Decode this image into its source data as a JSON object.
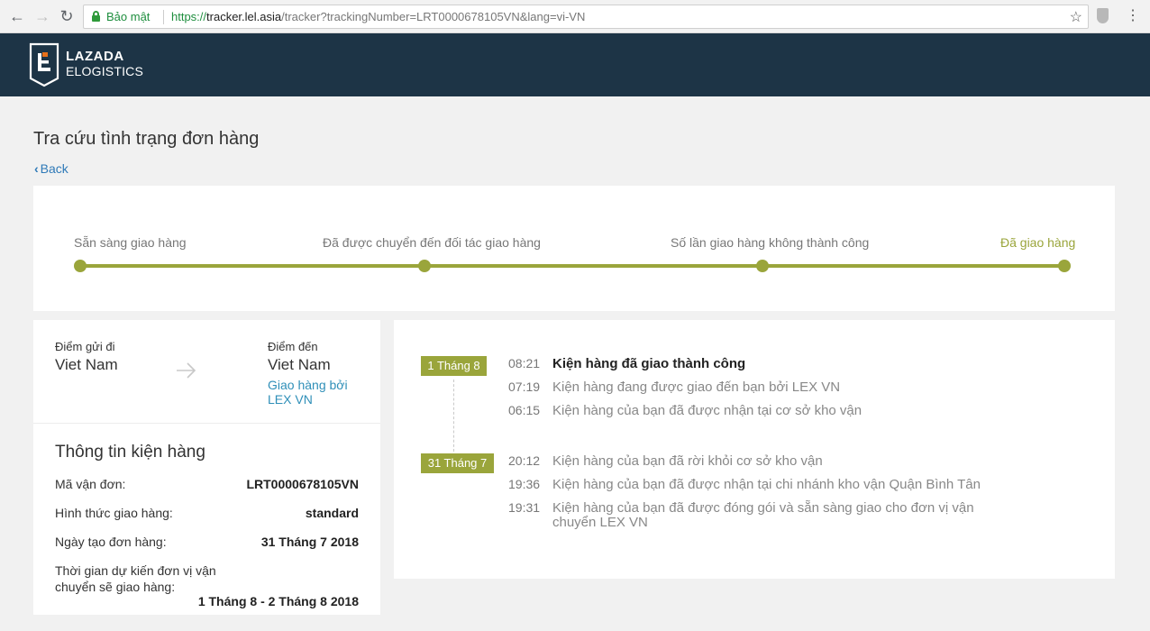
{
  "browser": {
    "secure_label": "Bảo mật",
    "url_scheme": "https://",
    "url_host": "tracker.lel.asia",
    "url_path": "/tracker?trackingNumber=LRT0000678105VN&lang=vi-VN"
  },
  "header": {
    "logo_line1": "LAZADA",
    "logo_line2": "ELOGISTICS",
    "brand_accent": "#e8701a",
    "bg_color": "#1d3446"
  },
  "page": {
    "title": "Tra cứu tình trạng đơn hàng",
    "back_label": "Back"
  },
  "progress": {
    "accent_color": "#9aa53b",
    "steps": [
      {
        "label": "Sẵn sàng giao hàng"
      },
      {
        "label": "Đã được chuyển đến đối tác giao hàng"
      },
      {
        "label": "Số lần giao hàng không thành công"
      },
      {
        "label": "Đã giao hàng"
      }
    ]
  },
  "route": {
    "origin_label": "Điểm gửi đi",
    "origin_value": "Viet Nam",
    "dest_label": "Điểm đến",
    "dest_value": "Viet Nam",
    "carrier": "Giao hàng bởi LEX VN"
  },
  "package": {
    "title": "Thông tin kiện hàng",
    "rows": [
      {
        "label": "Mã vận đơn:",
        "value": "LRT0000678105VN"
      },
      {
        "label": "Hình thức giao hàng:",
        "value": "standard"
      },
      {
        "label": "Ngày tạo đơn hàng:",
        "value": "31 Tháng 7 2018"
      },
      {
        "label": "Thời gian dự kiến đơn vị vận chuyển sẽ giao hàng:",
        "value": "1 Tháng 8 - 2 Tháng 8 2018"
      }
    ]
  },
  "timeline": {
    "groups": [
      {
        "date": "1 Tháng 8",
        "events": [
          {
            "time": "08:21",
            "text": "Kiện hàng đã giao thành công"
          },
          {
            "time": "07:19",
            "text": "Kiện hàng đang được giao đến bạn bởi LEX VN"
          },
          {
            "time": "06:15",
            "text": "Kiện hàng của bạn đã được nhận tại cơ sở kho vận"
          }
        ]
      },
      {
        "date": "31 Tháng 7",
        "events": [
          {
            "time": "20:12",
            "text": "Kiện hàng của bạn đã rời khỏi cơ sở kho vận"
          },
          {
            "time": "19:36",
            "text": "Kiện hàng của bạn đã được nhận tại chi nhánh kho vận Quận Bình Tân"
          },
          {
            "time": "19:31",
            "text": "Kiện hàng của bạn đã được đóng gói và sẵn sàng giao cho đơn vị vận chuyển LEX VN"
          }
        ]
      }
    ]
  }
}
